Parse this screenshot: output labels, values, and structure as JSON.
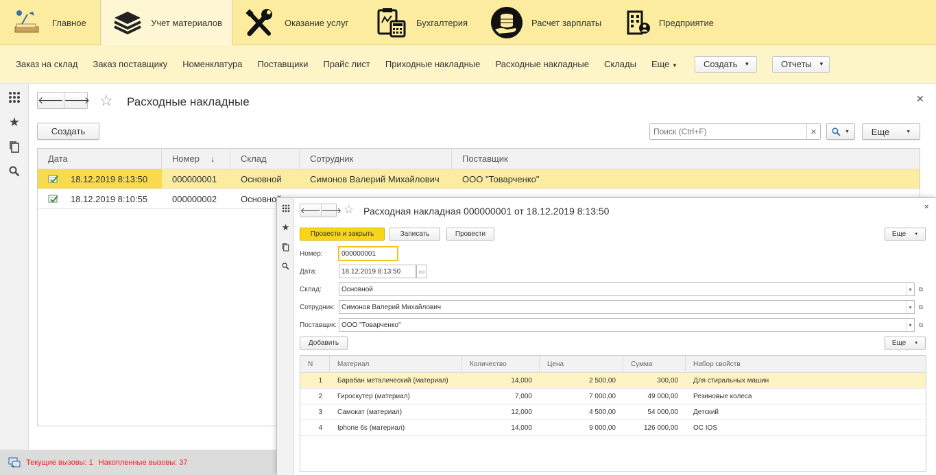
{
  "sections": [
    {
      "label": "Главное",
      "icon": "desk-lamp-icon"
    },
    {
      "label": "Учет материалов",
      "icon": "layers-icon"
    },
    {
      "label": "Оказание услуг",
      "icon": "tools-icon"
    },
    {
      "label": "Бухгалтерия",
      "icon": "calculator-icon"
    },
    {
      "label": "Расчет зарплаты",
      "icon": "coins-hand-icon"
    },
    {
      "label": "Предприятие",
      "icon": "building-icon"
    }
  ],
  "commands": [
    "Заказ на склад",
    "Заказ поставщику",
    "Номенклатура",
    "Поставщики",
    "Прайс лист",
    "Приходные накладные",
    "Расходные накладные",
    "Склады",
    "Еще"
  ],
  "command_buttons": {
    "create": "Создать",
    "reports": "Отчеты"
  },
  "list": {
    "title": "Расходные накладные",
    "create_label": "Создать",
    "search_placeholder": "Поиск (Ctrl+F)",
    "more_label": "Еще",
    "columns": [
      "Дата",
      "Номер",
      "Склад",
      "Сотрудник",
      "Поставщик"
    ],
    "sort_arrow": "↓",
    "rows": [
      {
        "date": "18.12.2019 8:13:50",
        "number": "000000001",
        "warehouse": "Основной",
        "employee": "Симонов Валерий Михайлович",
        "supplier": "ООО \"Товарченко\""
      },
      {
        "date": "18.12.2019 8:10:55",
        "number": "000000002",
        "warehouse": "Основной",
        "employee": "",
        "supplier": ""
      }
    ]
  },
  "status": {
    "current": "Текущие вызовы: 1",
    "accumulated": "Накопленные вызовы: 37"
  },
  "doc": {
    "title": "Расходная накладная 000000001 от 18.12.2019 8:13:50",
    "buttons": {
      "post_close": "Провести и закрыть",
      "save": "Записать",
      "post": "Провести",
      "more": "Еще",
      "add": "Добавить",
      "more2": "Еще"
    },
    "labels": {
      "number": "Номер:",
      "date": "Дата:",
      "warehouse": "Склад:",
      "employee": "Сотрудник:",
      "supplier": "Поставщик:"
    },
    "values": {
      "number": "000000001",
      "date": "18.12.2019  8:13:50",
      "warehouse": "Основной",
      "employee": "Симонов Валерий Михайлович",
      "supplier": "ООО \"Товарченко\""
    },
    "table_columns": [
      "N",
      "Материал",
      "Количество",
      "Цена",
      "Сумма",
      "Набор свойств"
    ],
    "table_rows": [
      {
        "n": "1",
        "material": "Барабан металический (материал)",
        "qty": "14,000",
        "price": "2 500,00",
        "sum": "300,00",
        "props": "Для стиральных машин"
      },
      {
        "n": "2",
        "material": "Гироскутер (материал)",
        "qty": "7,000",
        "price": "7 000,00",
        "sum": "49 000,00",
        "props": "Резиновые колеса"
      },
      {
        "n": "3",
        "material": "Самокат (материал)",
        "qty": "12,000",
        "price": "4 500,00",
        "sum": "54 000,00",
        "props": "Детский"
      },
      {
        "n": "4",
        "material": "Iphone 6s (материал)",
        "qty": "14,000",
        "price": "9 000,00",
        "sum": "126 000,00",
        "props": "ОС IOS"
      }
    ]
  }
}
